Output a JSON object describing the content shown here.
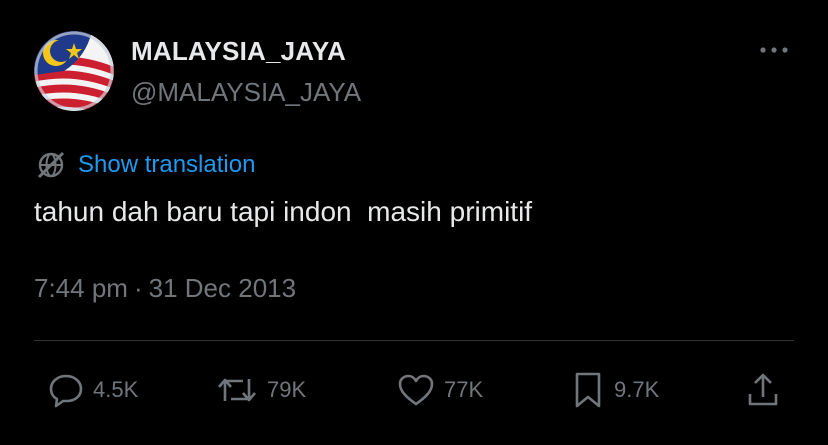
{
  "author": {
    "display_name": "MALAYSIA_JAYA",
    "handle": "@MALAYSIA_JAYA",
    "avatar_icon": "malaysia-flag-icon"
  },
  "translation": {
    "label": "Show translation",
    "icon": "globe-slash-icon"
  },
  "tweet": {
    "text": "tahun dah baru tapi indon  masih primitif",
    "time": "7:44 pm",
    "separator": "·",
    "date": "31 Dec 2013"
  },
  "actions": {
    "replies": "4.5K",
    "reposts": "79K",
    "likes": "77K",
    "bookmarks": "9.7K"
  },
  "colors": {
    "background": "#000000",
    "text": "#e7e9ea",
    "muted": "#71767b",
    "link": "#1d9bf0",
    "divider": "#2f3336"
  }
}
